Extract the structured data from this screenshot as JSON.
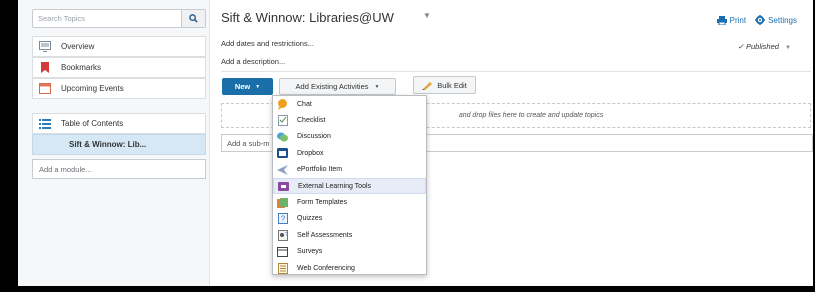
{
  "sidebar": {
    "search": {
      "placeholder": "Search Topics"
    },
    "items": [
      {
        "label": "Overview",
        "icon": "overview-icon"
      },
      {
        "label": "Bookmarks",
        "icon": "bookmark-icon"
      },
      {
        "label": "Upcoming Events",
        "icon": "calendar-icon"
      },
      {
        "label": "Table of Contents",
        "icon": "list-icon"
      },
      {
        "label": "Sift & Winnow: Lib..."
      }
    ],
    "add_module": {
      "placeholder": "Add a module..."
    }
  },
  "header": {
    "title": "Sift & Winnow: Libraries@UW",
    "print_label": "Print",
    "settings_label": "Settings"
  },
  "main": {
    "dates_label": "Add dates and restrictions...",
    "published_label": "Published",
    "description_label": "Add a description...",
    "new_label": "New",
    "add_existing_label": "Add Existing Activities",
    "bulk_edit_label": "Bulk Edit",
    "dropzone_text": "and drop files here to create and update topics",
    "submodule_placeholder": "Add a sub-m"
  },
  "menu": {
    "items": [
      {
        "label": "Chat",
        "icon": "chat-icon"
      },
      {
        "label": "Checklist",
        "icon": "checklist-icon"
      },
      {
        "label": "Discussion",
        "icon": "discussion-icon"
      },
      {
        "label": "Dropbox",
        "icon": "dropbox-icon"
      },
      {
        "label": "ePortfolio Item",
        "icon": "eportfolio-icon"
      },
      {
        "label": "External Learning Tools",
        "icon": "external-tools-icon"
      },
      {
        "label": "Form Templates",
        "icon": "form-templates-icon"
      },
      {
        "label": "Quizzes",
        "icon": "quizzes-icon"
      },
      {
        "label": "Self Assessments",
        "icon": "self-assessment-icon"
      },
      {
        "label": "Surveys",
        "icon": "surveys-icon"
      },
      {
        "label": "Web Conferencing",
        "icon": "web-conferencing-icon"
      }
    ],
    "hovered": "External Learning Tools"
  },
  "colors": {
    "primary": "#1a6fa8",
    "link": "#1a6fb3",
    "active_item": "#d6e8f5"
  }
}
